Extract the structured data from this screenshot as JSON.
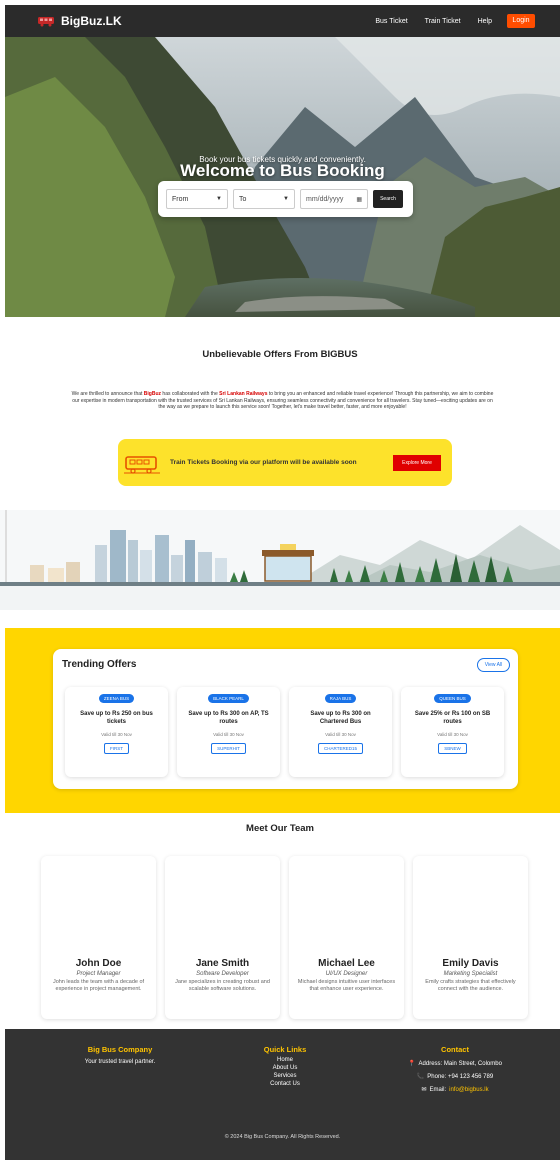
{
  "navbar": {
    "brand": "BigBuz.LK",
    "links": [
      "Bus Ticket",
      "Train Ticket",
      "Help"
    ],
    "login": "Login"
  },
  "hero": {
    "title": "Welcome to Bus Booking",
    "subtitle": "Book your bus tickets quickly and conveniently.",
    "from": "From",
    "to": "To",
    "date_placeholder": "mm/dd/yyyy",
    "search": "Search"
  },
  "offers": {
    "title": "Unbelievable Offers From BIGBUS",
    "text_1": "We are thrilled to announce that ",
    "brand": "BigBuz",
    "text_2": " has collaborated with the ",
    "partner": "Sri Lankan Railways",
    "text_3": " to bring you an enhanced and reliable travel experience! Through this partnership, we aim to combine our expertise in modern transportation with the trusted services of Sri Lankan Railways, ensuring seamless connectivity and convenience for all travelers. Stay tuned—exciting updates are on the way as we prepare to launch this service soon! Together, let's make travel better, faster, and more enjoyable!",
    "banner_text": "Train Tickets Booking via our platform will be available soon",
    "explore": "Explore More"
  },
  "trending": {
    "title": "Trending Offers",
    "view_all": "View All",
    "items": [
      {
        "chip": "ZEENA BUS",
        "title": "Save up to Rs 250 on bus tickets",
        "valid": "Valid till 30 Nov",
        "code": "FIRST"
      },
      {
        "chip": "BLACK PEARL",
        "title": "Save up to Rs 300 on AP, TS routes",
        "valid": "Valid till 30 Nov",
        "code": "SUPERHIT"
      },
      {
        "chip": "RAJA BUS",
        "title": "Save up to Rs 300 on Chartered Bus",
        "valid": "Valid till 30 Nov",
        "code": "CHARTERED15"
      },
      {
        "chip": "QUEEN BUS",
        "title": "Save 25% or Rs 100 on SB routes",
        "valid": "Valid till 30 Nov",
        "code": "SBNEW"
      }
    ]
  },
  "team": {
    "title": "Meet Our Team",
    "members": [
      {
        "name": "John Doe",
        "role": "Project Manager",
        "desc": "John leads the team with a decade of experience in project management."
      },
      {
        "name": "Jane Smith",
        "role": "Software Developer",
        "desc": "Jane specializes in creating robust and scalable software solutions."
      },
      {
        "name": "Michael Lee",
        "role": "UI/UX Designer",
        "desc": "Michael designs intuitive user interfaces that enhance user experience."
      },
      {
        "name": "Emily Davis",
        "role": "Marketing Specialist",
        "desc": "Emily crafts strategies that effectively connect with the audience."
      }
    ]
  },
  "footer": {
    "company": "Big Bus Company",
    "tagline": "Your trusted travel partner.",
    "quick_links_title": "Quick Links",
    "quick_links": [
      "Home",
      "About Us",
      "Services",
      "Contact Us"
    ],
    "contact_title": "Contact",
    "address": "Address: Main Street, Colombo",
    "phone": "Phone: +94 123 456 789",
    "email_label": "Email: ",
    "email": "info@bigbus.lk",
    "copyright": "© 2024 Big Bus Company. All Rights Reserved."
  },
  "colors": {
    "accent_orange": "#ff4d00",
    "yellow": "#ffd600",
    "blue": "#1a73e8",
    "red": "#e00000",
    "dark": "#2b2b2b"
  }
}
